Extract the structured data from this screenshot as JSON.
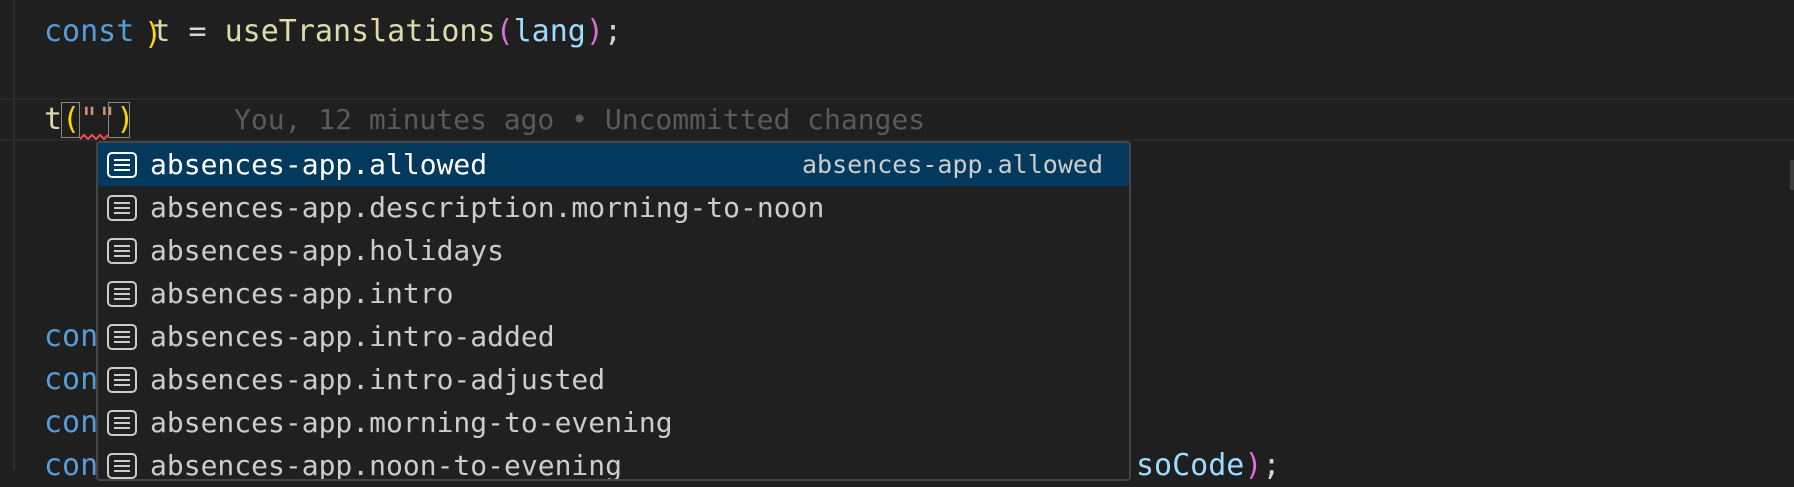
{
  "code": {
    "line1": {
      "kw": "const",
      "space1": " ",
      "var": "t",
      "op": " = ",
      "fn": "useTranslations",
      "paren_open": "(",
      "arg": "lang",
      "paren_close": ")",
      "semi": ";"
    },
    "line2": {
      "fn": "t",
      "paren_open": "(",
      "str": "\"\"",
      "paren_close": ")"
    },
    "partial_lines": [
      {
        "text": "con"
      },
      {
        "text": "con"
      },
      {
        "text": "con"
      },
      {
        "text": "con"
      }
    ],
    "tail_line": {
      "var": "soCode",
      "paren_close": ")",
      "semi": ";"
    },
    "blame": "You, 12 minutes ago • Uncommitted changes"
  },
  "suggestions": {
    "selected_detail": "absences-app.allowed",
    "items": [
      {
        "label": "absences-app.allowed",
        "icon": "text-icon"
      },
      {
        "label": "absences-app.description.morning-to-noon",
        "icon": "text-icon"
      },
      {
        "label": "absences-app.holidays",
        "icon": "text-icon"
      },
      {
        "label": "absences-app.intro",
        "icon": "text-icon"
      },
      {
        "label": "absences-app.intro-added",
        "icon": "text-icon"
      },
      {
        "label": "absences-app.intro-adjusted",
        "icon": "text-icon"
      },
      {
        "label": "absences-app.morning-to-evening",
        "icon": "text-icon"
      },
      {
        "label": "absences-app.noon-to-evening",
        "icon": "text-icon"
      }
    ]
  },
  "colors": {
    "background": "#1f1f1f",
    "selection": "#04395e",
    "keyword": "#569cd6",
    "function": "#dcdcaa",
    "variable": "#9cdcfe",
    "string": "#ce9178"
  }
}
